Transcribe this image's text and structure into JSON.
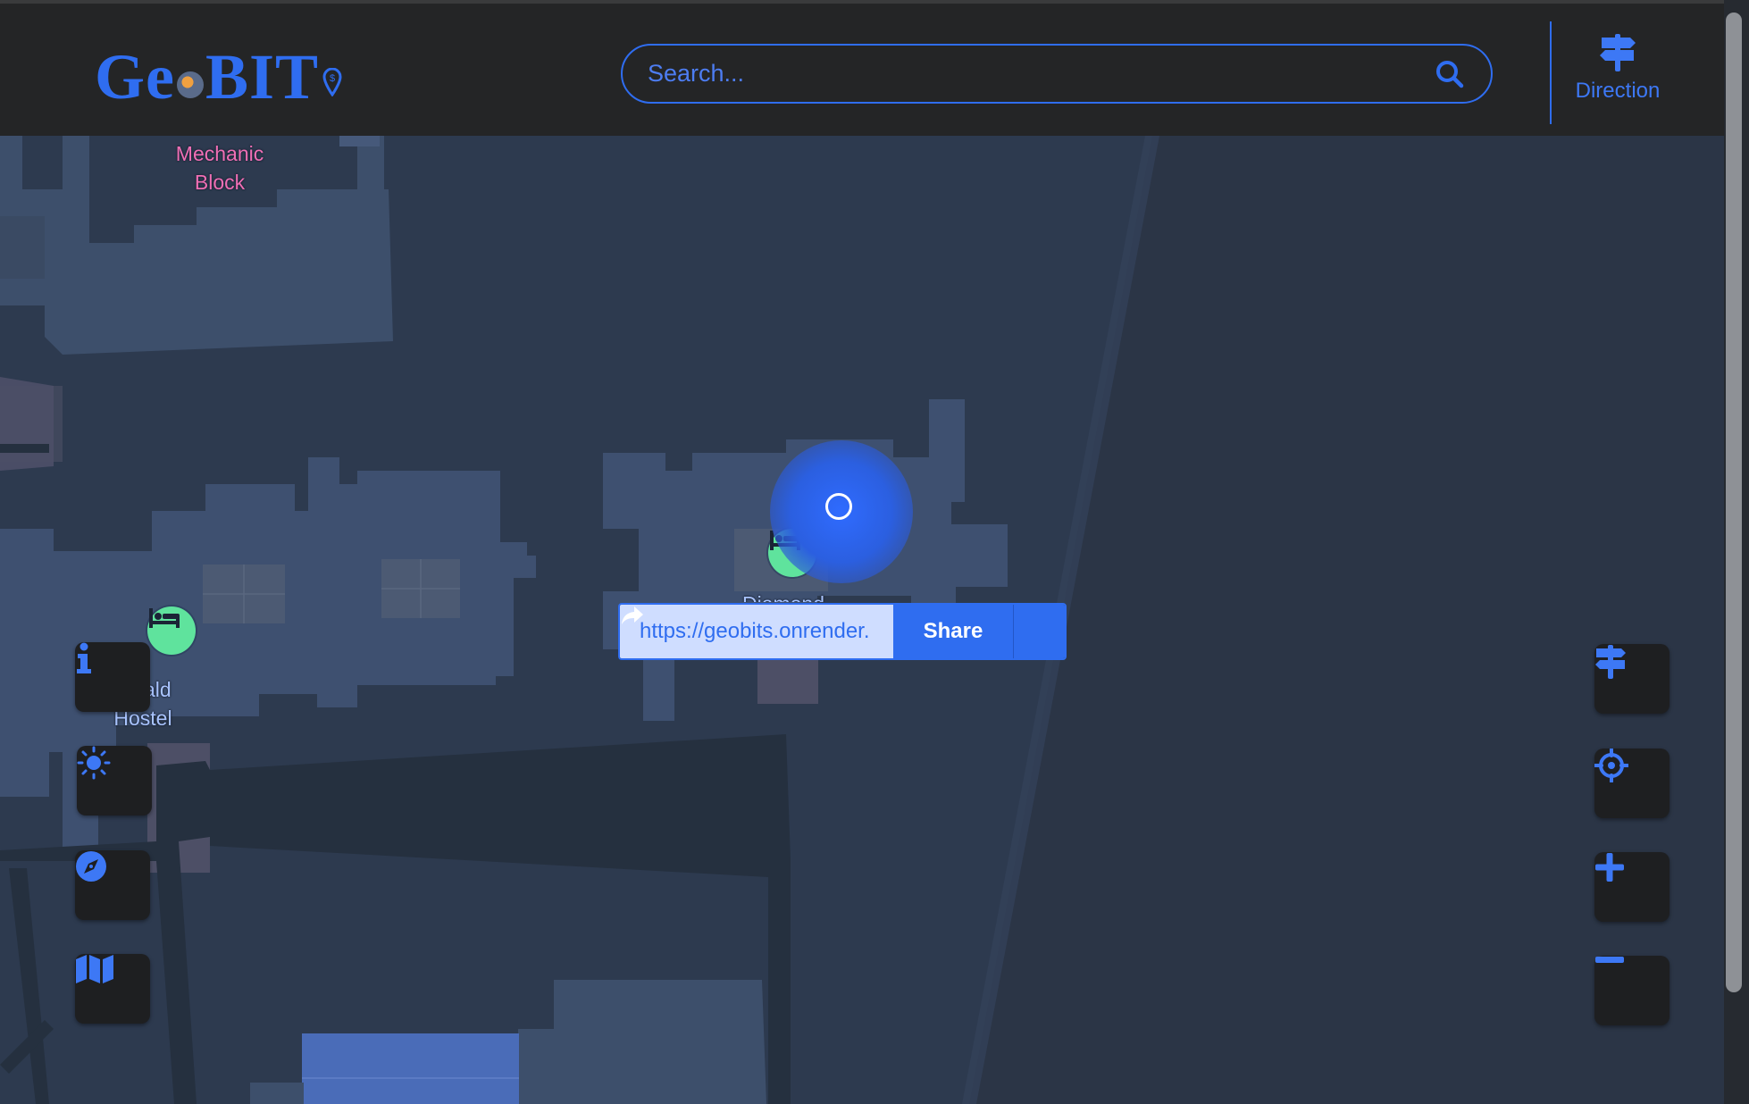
{
  "app": {
    "logo_text": "GeoBIT"
  },
  "header": {
    "search_placeholder": "Search...",
    "direction_label": "Direction"
  },
  "map": {
    "labels": {
      "mechanic_line1": "Mechanic",
      "mechanic_line2": "Block",
      "emerald_line1": "ald",
      "emerald_line2": "Hostel",
      "diamond_partial": "Diamond"
    }
  },
  "share_popup": {
    "url": "https://geobits.onrender.",
    "share_label": "Share"
  },
  "controls": {
    "left": [
      "info-icon",
      "sun-icon",
      "compass-icon",
      "map-icon"
    ],
    "right": [
      "signpost-icon",
      "crosshair-icon",
      "plus-icon",
      "minus-icon"
    ]
  },
  "colors": {
    "accent": "#2f6df0",
    "header_bg": "#242526",
    "map_bg": "#2d3a4f",
    "poi_green": "#5fe39d",
    "label_pink": "#f06fb5"
  }
}
